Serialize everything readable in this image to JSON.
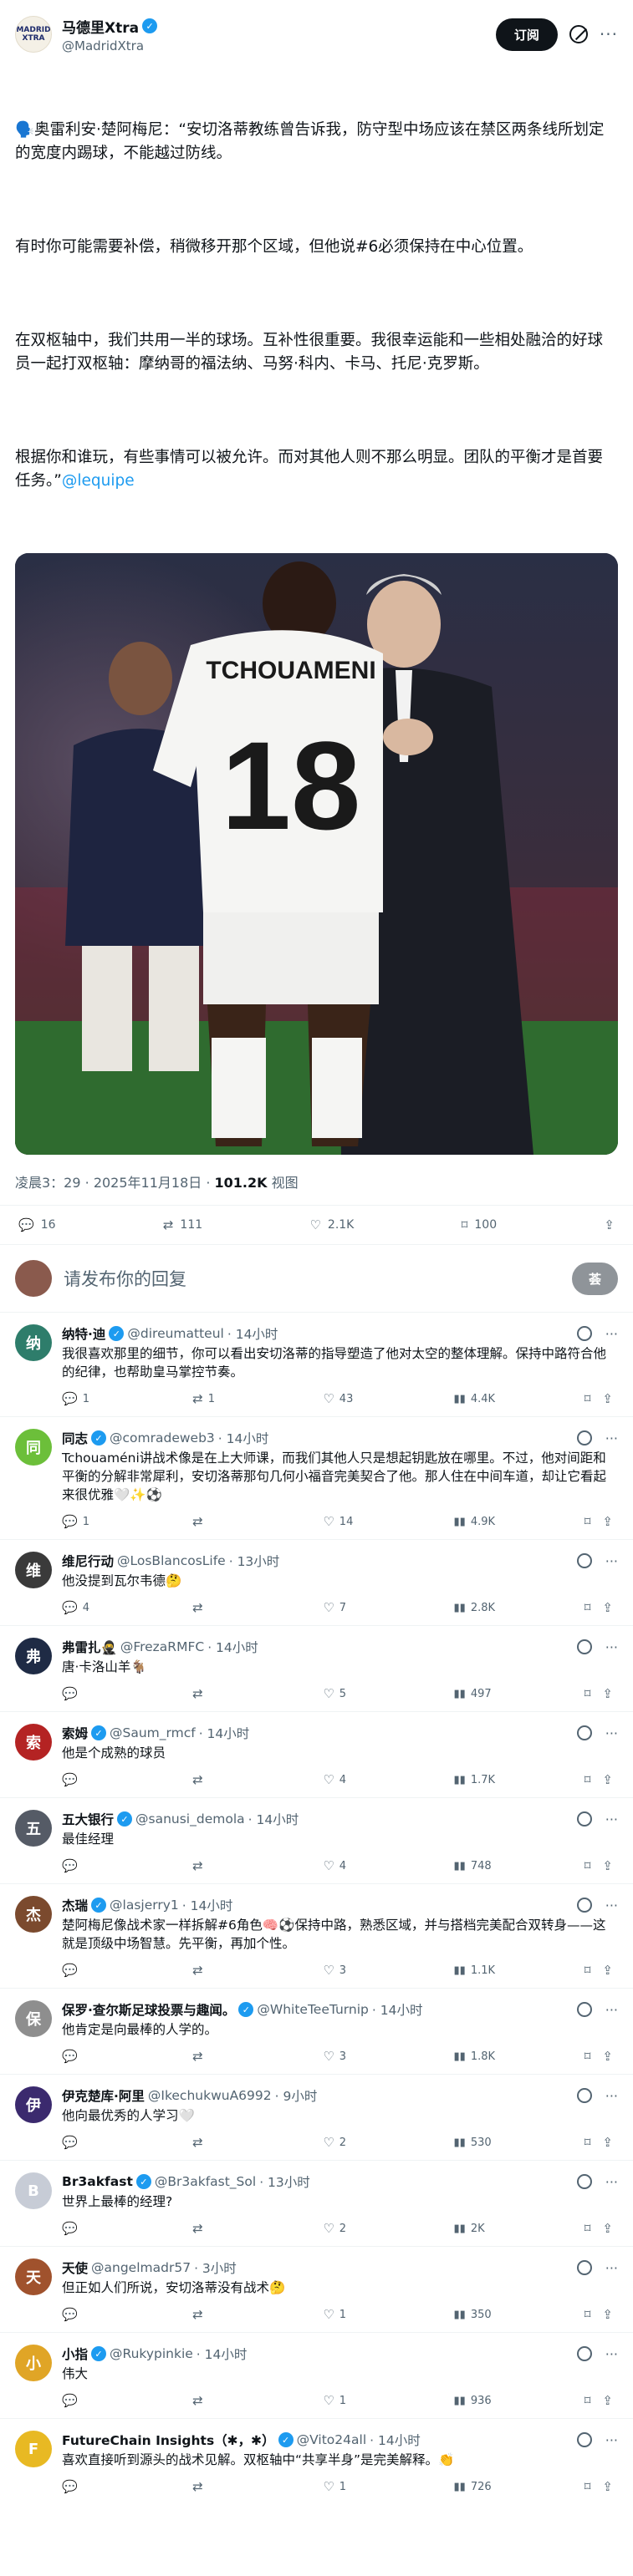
{
  "author": {
    "name": "马德里Xtra",
    "handle": "@MadridXtra",
    "logo_text": "MADRID XTRA"
  },
  "header": {
    "subscribe_label": "订阅"
  },
  "tweet": {
    "paragraphs": [
      "🗣️奥雷利安·楚阿梅尼：“安切洛蒂教练曾告诉我，防守型中场应该在禁区两条线所划定的宽度内踢球，不能越过防线。",
      "有时你可能需要补偿，稍微移开那个区域，但他说#6必须保持在中心位置。",
      "在双枢轴中，我们共用一半的球场。互补性很重要。我很幸运能和一些相处融洽的好球员一起打双枢轴：摩纳哥的福法纳、马努·科内、卡马、托尼·克罗斯。",
      "根据你和谁玩，有些事情可以被允许。而对其他人则不那么明显。团队的平衡才是首要任务。”"
    ],
    "mention": "@lequipe",
    "photo": {
      "jersey_name": "TCHOUAMENI",
      "jersey_number": "18"
    },
    "time": "凌晨3：29",
    "date": "2025年11月18日",
    "views_count": "101.2K",
    "views_label": "视图",
    "stats": {
      "replies": "16",
      "retweets": "111",
      "likes": "2.1K",
      "bookmarks": "100"
    }
  },
  "compose": {
    "placeholder": "请发布你的回复",
    "button_label": "荟"
  },
  "replies": [
    {
      "name": "纳特·迪",
      "verified": true,
      "handle": "@direumatteul",
      "time": "· 14小时",
      "text": "我很喜欢那里的细节，你可以看出安切洛蒂的指导塑造了他对太空的整体理解。保持中路符合他的纪律，也帮助皇马掌控节奏。",
      "replies": "1",
      "retweets": "1",
      "likes": "43",
      "views": "4.4K",
      "avatar_color": "#2e7d6b",
      "avatar_text": "纳"
    },
    {
      "name": "同志",
      "verified": true,
      "handle": "@comradeweb3",
      "time": "· 14小时",
      "text": "Tchouaméni讲战术像是在上大师课，而我们其他人只是想起钥匙放在哪里。不过，他对间距和平衡的分解非常犀利，安切洛蒂那句几何小福音完美契合了他。那人住在中间车道，却让它看起来很优雅🤍✨⚽",
      "replies": "1",
      "retweets": "",
      "likes": "14",
      "views": "4.9K",
      "avatar_color": "#6cbf3a",
      "avatar_text": "同"
    },
    {
      "name": "维尼行动",
      "verified": false,
      "handle": "@LosBlancosLife",
      "time": "· 13小时",
      "text": "他没提到瓦尔韦德🤔",
      "replies": "4",
      "retweets": "",
      "likes": "7",
      "views": "2.8K",
      "avatar_color": "#3a3a3a",
      "avatar_text": "维"
    },
    {
      "name": "弗雷扎🥷",
      "verified": false,
      "handle": "@FrezaRMFC",
      "time": "· 14小时",
      "text": "唐·卡洛山羊🐐",
      "replies": "",
      "retweets": "",
      "likes": "5",
      "views": "497",
      "avatar_color": "#1f2b45",
      "avatar_text": "弗"
    },
    {
      "name": "索姆",
      "verified": true,
      "handle": "@Saum_rmcf",
      "time": "· 14小时",
      "text": "他是个成熟的球员",
      "replies": "",
      "retweets": "",
      "likes": "4",
      "views": "1.7K",
      "avatar_color": "#b42323",
      "avatar_text": "索"
    },
    {
      "name": "五大银行",
      "verified": true,
      "handle": "@sanusi_demola",
      "time": "· 14小时",
      "text": "最佳经理",
      "replies": "",
      "retweets": "",
      "likes": "4",
      "views": "748",
      "avatar_color": "#555b66",
      "avatar_text": "五"
    },
    {
      "name": "杰瑞",
      "verified": true,
      "handle": "@lasjerry1",
      "time": "· 14小时",
      "text": "楚阿梅尼像战术家一样拆解#6角色🧠⚽保持中路，熟悉区域，并与搭档完美配合双转身——这就是顶级中场智慧。先平衡，再加个性。",
      "replies": "",
      "retweets": "",
      "likes": "3",
      "views": "1.1K",
      "avatar_color": "#7b4a2e",
      "avatar_text": "杰"
    },
    {
      "name": "保罗·查尔斯足球投票与趣闻。",
      "verified": true,
      "handle": "@WhiteTeeTurnip",
      "time": "· 14小时",
      "text": "他肯定是向最棒的人学的。",
      "replies": "",
      "retweets": "",
      "likes": "3",
      "views": "1.8K",
      "avatar_color": "#8e8e8e",
      "avatar_text": "保"
    },
    {
      "name": "伊克楚库·阿里",
      "verified": false,
      "handle": "@IkechukwuA6992",
      "time": "· 9小时",
      "text": "他向最优秀的人学习🤍",
      "replies": "",
      "retweets": "",
      "likes": "2",
      "views": "530",
      "avatar_color": "#3b2a6e",
      "avatar_text": "伊"
    },
    {
      "name": "Br3akfast",
      "verified": true,
      "handle": "@Br3akfast_Sol",
      "time": "· 13小时",
      "text": "世界上最棒的经理?",
      "replies": "",
      "retweets": "",
      "likes": "2",
      "views": "2K",
      "avatar_color": "#c7ccd6",
      "avatar_text": "B"
    },
    {
      "name": "天使",
      "verified": false,
      "handle": "@angelmadr57",
      "time": "· 3小时",
      "text": "但正如人们所说，安切洛蒂没有战术🤔",
      "replies": "",
      "retweets": "",
      "likes": "1",
      "views": "350",
      "avatar_color": "#a0522d",
      "avatar_text": "天"
    },
    {
      "name": "小指",
      "verified": true,
      "handle": "@Rukypinkie",
      "time": "· 14小时",
      "text": "伟大",
      "replies": "",
      "retweets": "",
      "likes": "1",
      "views": "936",
      "avatar_color": "#e0a526",
      "avatar_text": "小"
    },
    {
      "name": "FutureChain Insights（✱，✱）",
      "verified": true,
      "handle": "@Vito24all",
      "time": "· 14小时",
      "text": "喜欢直接听到源头的战术见解。双枢轴中“共享半身”是完美解释。👏",
      "replies": "",
      "retweets": "",
      "likes": "1",
      "views": "726",
      "avatar_color": "#e8b923",
      "avatar_text": "F"
    }
  ],
  "colors": {
    "accent": "#1d9bf0",
    "text": "#0f1419",
    "muted": "#536471"
  },
  "icons": {
    "reply": "reply-icon",
    "retweet": "retweet-icon",
    "like": "heart-icon",
    "views": "bar-chart-icon",
    "bookmark": "bookmark-icon",
    "share": "share-icon"
  }
}
